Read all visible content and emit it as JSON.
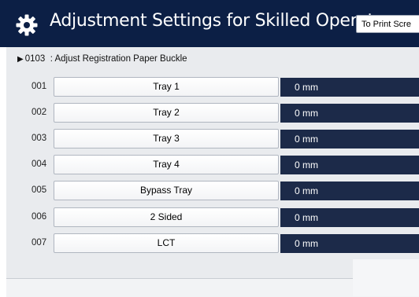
{
  "header": {
    "title": "Adjustment Settings for Skilled Operators",
    "print_button_label": "To Print Scre"
  },
  "section": {
    "code": "0103",
    "label": ": Adjust Registration Paper Buckle"
  },
  "rows": [
    {
      "num": "001",
      "label": "Tray 1",
      "value": "0 mm"
    },
    {
      "num": "002",
      "label": "Tray 2",
      "value": "0 mm"
    },
    {
      "num": "003",
      "label": "Tray 3",
      "value": "0 mm"
    },
    {
      "num": "004",
      "label": "Tray 4",
      "value": "0 mm"
    },
    {
      "num": "005",
      "label": "Bypass Tray",
      "value": "0 mm"
    },
    {
      "num": "006",
      "label": "2 Sided",
      "value": "0 mm"
    },
    {
      "num": "007",
      "label": "LCT",
      "value": "0 mm"
    }
  ],
  "colors": {
    "header_bg": "#0c1f45",
    "value_bg": "#1c2a49",
    "panel_bg": "#e9ebee"
  },
  "icons": {
    "header_icon": "gear-icon",
    "section_marker": "triangle-right-icon"
  }
}
